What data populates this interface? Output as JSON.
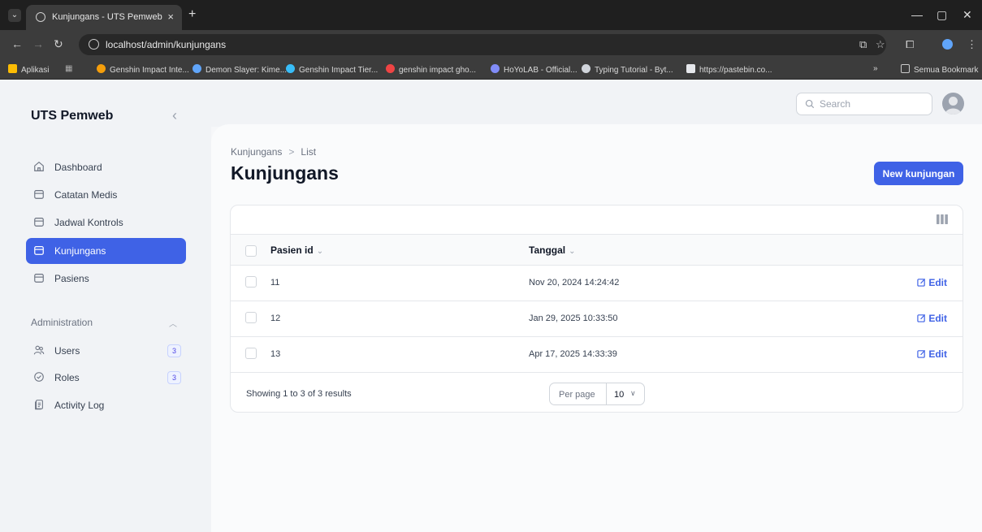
{
  "browser": {
    "tab_title": "Kunjungans - UTS Pemweb",
    "tab_close": "×",
    "new_tab": "+",
    "url": "localhost/admin/kunjungans",
    "bookmarks": [
      {
        "label": "Aplikasi",
        "color": "#fbbc04"
      },
      {
        "label": "Genshin Impact Inte...",
        "color": "#f59e0b"
      },
      {
        "label": "Demon Slayer: Kime...",
        "color": "#60a5fa"
      },
      {
        "label": "Genshin Impact Tier...",
        "color": "#38bdf8"
      },
      {
        "label": "genshin impact gho...",
        "color": "#ef4444"
      },
      {
        "label": "HoYoLAB - Official...",
        "color": "#818cf8"
      },
      {
        "label": "Typing Tutorial - Byt...",
        "color": "#d1d5db"
      },
      {
        "label": "https://pastebin.co...",
        "color": "#e5e7eb"
      }
    ],
    "more_bookmarks": "»",
    "all_bookmarks": "Semua Bookmark"
  },
  "sidebar": {
    "brand": "UTS Pemweb",
    "collapse": "‹",
    "items": [
      {
        "label": "Dashboard"
      },
      {
        "label": "Catatan Medis"
      },
      {
        "label": "Jadwal Kontrols"
      },
      {
        "label": "Kunjungans"
      },
      {
        "label": "Pasiens"
      }
    ],
    "admin_group": "Administration",
    "admin_items": [
      {
        "label": "Users",
        "badge": "3"
      },
      {
        "label": "Roles",
        "badge": "3"
      },
      {
        "label": "Activity Log"
      }
    ]
  },
  "topbar": {
    "search_placeholder": "Search"
  },
  "main": {
    "breadcrumb": [
      "Kunjungans",
      "List"
    ],
    "breadcrumb_sep": ">",
    "title": "Kunjungans",
    "new_button": "New kunjungan",
    "columns": [
      "Pasien id",
      "Tanggal"
    ],
    "sort_chevron": "⌄",
    "rows": [
      {
        "pasien_id": "11",
        "tanggal": "Nov 20, 2024 14:24:42"
      },
      {
        "pasien_id": "12",
        "tanggal": "Jan 29, 2025 10:33:50"
      },
      {
        "pasien_id": "13",
        "tanggal": "Apr 17, 2025 14:33:39"
      }
    ],
    "edit_label": "Edit",
    "showing": "Showing 1 to 3 of 3 results",
    "per_page_label": "Per page",
    "per_page_value": "10"
  },
  "colors": {
    "accent": "#3f62e6"
  }
}
